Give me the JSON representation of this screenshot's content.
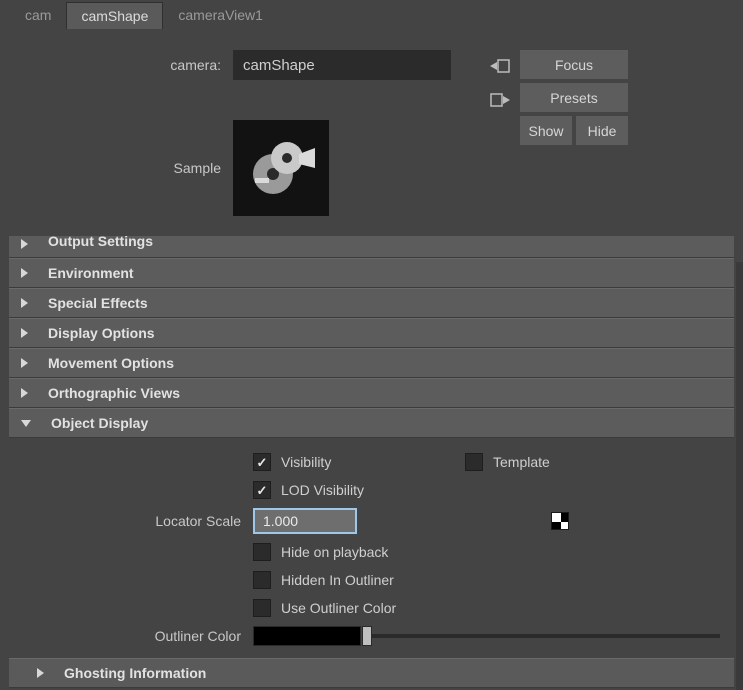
{
  "tabs": [
    {
      "label": "cam",
      "active": false
    },
    {
      "label": "camShape",
      "active": true
    },
    {
      "label": "cameraView1",
      "active": false
    }
  ],
  "header": {
    "name_label": "camera:",
    "name_value": "camShape",
    "sample_label": "Sample"
  },
  "buttons": {
    "focus": "Focus",
    "presets": "Presets",
    "show": "Show",
    "hide": "Hide"
  },
  "sections": {
    "output_settings": "Output Settings",
    "environment": "Environment",
    "special_effects": "Special Effects",
    "display_options": "Display Options",
    "movement_options": "Movement Options",
    "orthographic_views": "Orthographic Views",
    "object_display": "Object Display",
    "ghosting_info": "Ghosting Information"
  },
  "object_display": {
    "visibility": {
      "label": "Visibility",
      "checked": true
    },
    "template": {
      "label": "Template",
      "checked": false
    },
    "lod_visibility": {
      "label": "LOD Visibility",
      "checked": true
    },
    "locator_scale_label": "Locator Scale",
    "locator_scale_value": "1.000",
    "hide_on_playback": {
      "label": "Hide on playback",
      "checked": false
    },
    "hidden_in_outliner": {
      "label": "Hidden In Outliner",
      "checked": false
    },
    "use_outliner_color": {
      "label": "Use Outliner Color",
      "checked": false
    },
    "outliner_color_label": "Outliner Color",
    "outliner_color_value": "#000000",
    "outliner_color_slider": 0
  }
}
